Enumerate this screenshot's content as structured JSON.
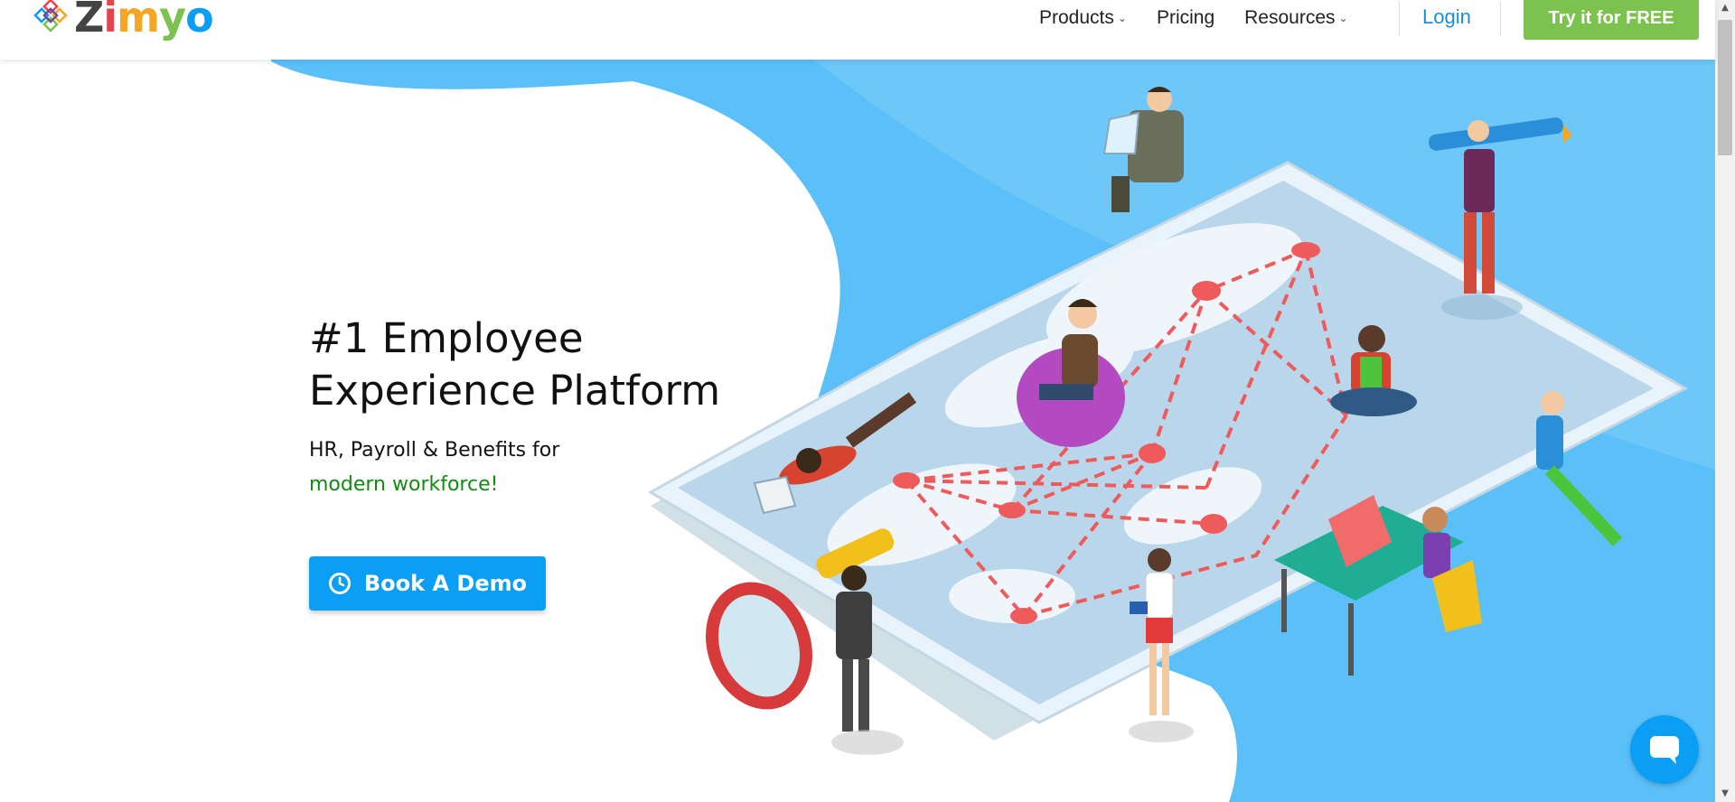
{
  "brand": {
    "name_parts": [
      "Z",
      "i",
      "m",
      "y",
      "o"
    ],
    "colors": [
      "#444444",
      "#e6424b",
      "#f5a623",
      "#7cc24f",
      "#0a9ef4"
    ]
  },
  "nav": {
    "products": "Products",
    "pricing": "Pricing",
    "resources": "Resources",
    "login": "Login",
    "try_free": "Try it for FREE"
  },
  "hero": {
    "title_line1": "#1 Employee",
    "title_line2": "Experience Platform",
    "subtitle_line1": "HR, Payroll & Benefits for",
    "subtitle_line2": "modern workforce!",
    "cta_label": "Book A Demo"
  },
  "theme": {
    "accent": "#0a9ef4",
    "cta_green": "#7cc24f",
    "highlight_green": "#128b12",
    "hero_blue": "#5bc0f8"
  },
  "icons": [
    "logo-mark-icon",
    "chevron-down-icon",
    "clock-icon",
    "chat-icon"
  ]
}
